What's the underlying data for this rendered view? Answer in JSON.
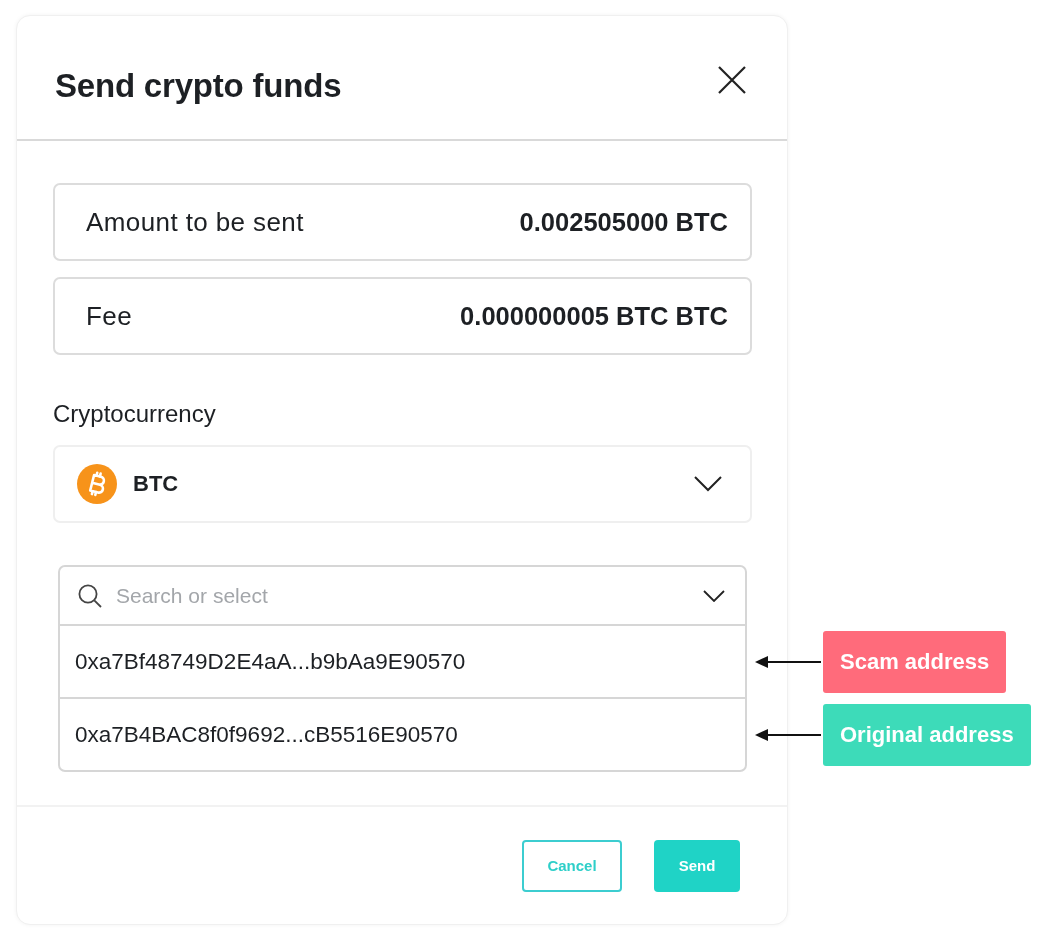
{
  "dialog": {
    "title": "Send crypto funds"
  },
  "summary": [
    {
      "label": "Amount to be sent",
      "value": "0.002505000 BTC"
    },
    {
      "label": "Fee",
      "value": "0.000000005 BTC BTC"
    }
  ],
  "currency": {
    "label": "Cryptocurrency",
    "value": "BTC"
  },
  "address_picker": {
    "placeholder": "Search or select",
    "options": [
      {
        "address": "0xa7Bf48749D2E4aA...b9bAa9E90570",
        "annotation": {
          "text": "Scam address",
          "color": "#ff6b7b"
        }
      },
      {
        "address": "0xa7B4BAC8f0f9692...cB5516E90570",
        "annotation": {
          "text": "Original address",
          "color": "#3ddbb9"
        }
      }
    ]
  },
  "buttons": [
    {
      "label": "Cancel",
      "kind": "secondary"
    },
    {
      "label": "Send",
      "kind": "primary"
    }
  ]
}
